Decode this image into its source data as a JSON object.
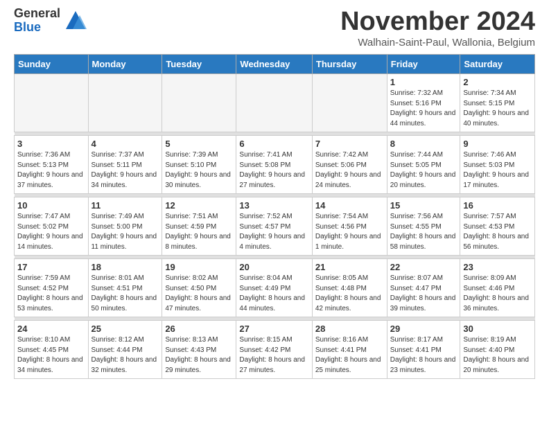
{
  "header": {
    "logo_general": "General",
    "logo_blue": "Blue",
    "month_title": "November 2024",
    "location": "Walhain-Saint-Paul, Wallonia, Belgium"
  },
  "calendar": {
    "days_of_week": [
      "Sunday",
      "Monday",
      "Tuesday",
      "Wednesday",
      "Thursday",
      "Friday",
      "Saturday"
    ],
    "weeks": [
      [
        {
          "day": "",
          "info": ""
        },
        {
          "day": "",
          "info": ""
        },
        {
          "day": "",
          "info": ""
        },
        {
          "day": "",
          "info": ""
        },
        {
          "day": "",
          "info": ""
        },
        {
          "day": "1",
          "info": "Sunrise: 7:32 AM\nSunset: 5:16 PM\nDaylight: 9 hours and 44 minutes."
        },
        {
          "day": "2",
          "info": "Sunrise: 7:34 AM\nSunset: 5:15 PM\nDaylight: 9 hours and 40 minutes."
        }
      ],
      [
        {
          "day": "3",
          "info": "Sunrise: 7:36 AM\nSunset: 5:13 PM\nDaylight: 9 hours and 37 minutes."
        },
        {
          "day": "4",
          "info": "Sunrise: 7:37 AM\nSunset: 5:11 PM\nDaylight: 9 hours and 34 minutes."
        },
        {
          "day": "5",
          "info": "Sunrise: 7:39 AM\nSunset: 5:10 PM\nDaylight: 9 hours and 30 minutes."
        },
        {
          "day": "6",
          "info": "Sunrise: 7:41 AM\nSunset: 5:08 PM\nDaylight: 9 hours and 27 minutes."
        },
        {
          "day": "7",
          "info": "Sunrise: 7:42 AM\nSunset: 5:06 PM\nDaylight: 9 hours and 24 minutes."
        },
        {
          "day": "8",
          "info": "Sunrise: 7:44 AM\nSunset: 5:05 PM\nDaylight: 9 hours and 20 minutes."
        },
        {
          "day": "9",
          "info": "Sunrise: 7:46 AM\nSunset: 5:03 PM\nDaylight: 9 hours and 17 minutes."
        }
      ],
      [
        {
          "day": "10",
          "info": "Sunrise: 7:47 AM\nSunset: 5:02 PM\nDaylight: 9 hours and 14 minutes."
        },
        {
          "day": "11",
          "info": "Sunrise: 7:49 AM\nSunset: 5:00 PM\nDaylight: 9 hours and 11 minutes."
        },
        {
          "day": "12",
          "info": "Sunrise: 7:51 AM\nSunset: 4:59 PM\nDaylight: 9 hours and 8 minutes."
        },
        {
          "day": "13",
          "info": "Sunrise: 7:52 AM\nSunset: 4:57 PM\nDaylight: 9 hours and 4 minutes."
        },
        {
          "day": "14",
          "info": "Sunrise: 7:54 AM\nSunset: 4:56 PM\nDaylight: 9 hours and 1 minute."
        },
        {
          "day": "15",
          "info": "Sunrise: 7:56 AM\nSunset: 4:55 PM\nDaylight: 8 hours and 58 minutes."
        },
        {
          "day": "16",
          "info": "Sunrise: 7:57 AM\nSunset: 4:53 PM\nDaylight: 8 hours and 56 minutes."
        }
      ],
      [
        {
          "day": "17",
          "info": "Sunrise: 7:59 AM\nSunset: 4:52 PM\nDaylight: 8 hours and 53 minutes."
        },
        {
          "day": "18",
          "info": "Sunrise: 8:01 AM\nSunset: 4:51 PM\nDaylight: 8 hours and 50 minutes."
        },
        {
          "day": "19",
          "info": "Sunrise: 8:02 AM\nSunset: 4:50 PM\nDaylight: 8 hours and 47 minutes."
        },
        {
          "day": "20",
          "info": "Sunrise: 8:04 AM\nSunset: 4:49 PM\nDaylight: 8 hours and 44 minutes."
        },
        {
          "day": "21",
          "info": "Sunrise: 8:05 AM\nSunset: 4:48 PM\nDaylight: 8 hours and 42 minutes."
        },
        {
          "day": "22",
          "info": "Sunrise: 8:07 AM\nSunset: 4:47 PM\nDaylight: 8 hours and 39 minutes."
        },
        {
          "day": "23",
          "info": "Sunrise: 8:09 AM\nSunset: 4:46 PM\nDaylight: 8 hours and 36 minutes."
        }
      ],
      [
        {
          "day": "24",
          "info": "Sunrise: 8:10 AM\nSunset: 4:45 PM\nDaylight: 8 hours and 34 minutes."
        },
        {
          "day": "25",
          "info": "Sunrise: 8:12 AM\nSunset: 4:44 PM\nDaylight: 8 hours and 32 minutes."
        },
        {
          "day": "26",
          "info": "Sunrise: 8:13 AM\nSunset: 4:43 PM\nDaylight: 8 hours and 29 minutes."
        },
        {
          "day": "27",
          "info": "Sunrise: 8:15 AM\nSunset: 4:42 PM\nDaylight: 8 hours and 27 minutes."
        },
        {
          "day": "28",
          "info": "Sunrise: 8:16 AM\nSunset: 4:41 PM\nDaylight: 8 hours and 25 minutes."
        },
        {
          "day": "29",
          "info": "Sunrise: 8:17 AM\nSunset: 4:41 PM\nDaylight: 8 hours and 23 minutes."
        },
        {
          "day": "30",
          "info": "Sunrise: 8:19 AM\nSunset: 4:40 PM\nDaylight: 8 hours and 20 minutes."
        }
      ]
    ]
  }
}
